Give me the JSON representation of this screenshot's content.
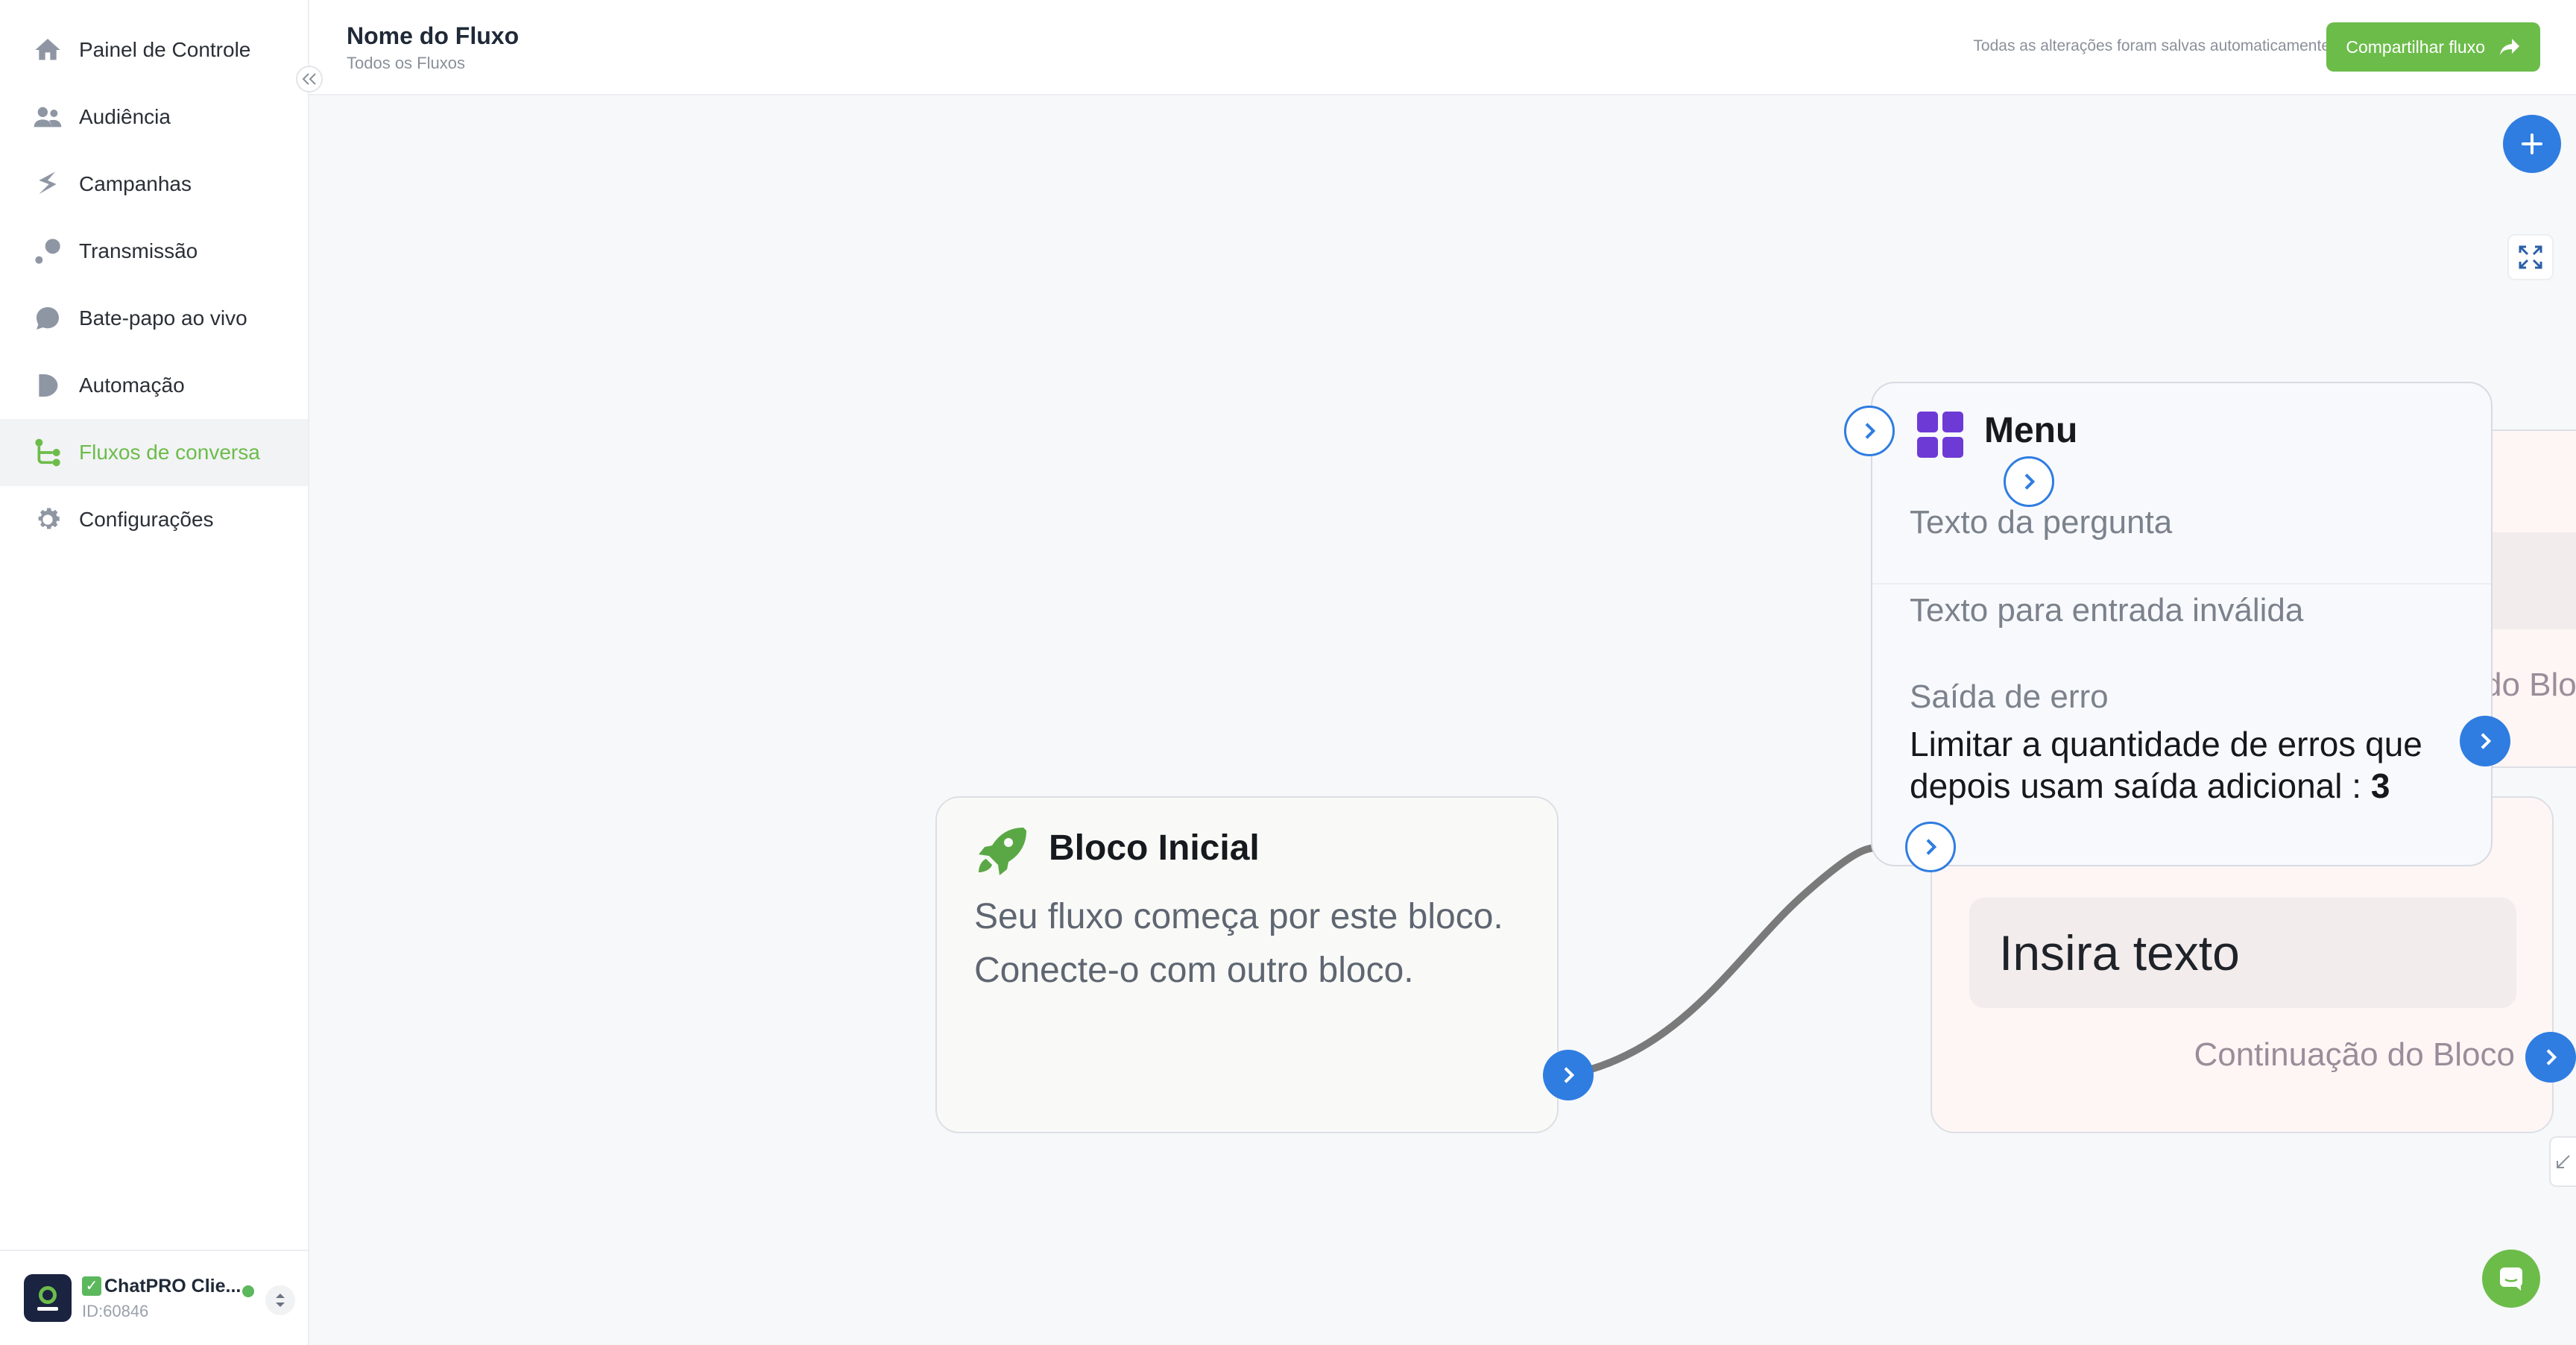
{
  "sidebar": {
    "items": [
      {
        "label": "Painel de Controle",
        "icon": "home-icon"
      },
      {
        "label": "Audiência",
        "icon": "users-icon"
      },
      {
        "label": "Campanhas",
        "icon": "campaigns-icon"
      },
      {
        "label": "Transmissão",
        "icon": "broadcast-icon"
      },
      {
        "label": "Bate-papo ao vivo",
        "icon": "chat-bubble-icon"
      },
      {
        "label": "Automação",
        "icon": "automation-icon"
      },
      {
        "label": "Fluxos de conversa",
        "icon": "flow-icon",
        "active": true
      },
      {
        "label": "Configurações",
        "icon": "gear-icon"
      }
    ],
    "account": {
      "name": "ChatPRO Clie...",
      "id": "ID:60846",
      "logo_text": "ChatPRO"
    }
  },
  "header": {
    "flow_name": "Nome do Fluxo",
    "breadcrumb": "Todos os Fluxos",
    "save_status": "Todas as alterações foram salvas automaticamente",
    "share_label": "Compartilhar fluxo"
  },
  "canvas": {
    "start_block": {
      "title": "Bloco Inicial",
      "line1": "Seu fluxo começa por este bloco.",
      "line2": "Conecte-o com outro bloco."
    },
    "menu_block": {
      "title": "Menu",
      "question": "Texto da pergunta",
      "invalid": "Texto para entrada inválida",
      "error_exit": "Saída de erro",
      "limit_text": "Limitar a quantidade de erros que depois usam saída adicional : ",
      "limit_value": "3"
    },
    "text_block": {
      "placeholder": "Insira texto",
      "continuation": "Continuação do Bloco"
    },
    "behind_block": {
      "label": "do Blo"
    }
  },
  "colors": {
    "accent_green": "#6cbc4a",
    "port_blue": "#2f7de1",
    "menu_purple": "#6d3ad6"
  }
}
